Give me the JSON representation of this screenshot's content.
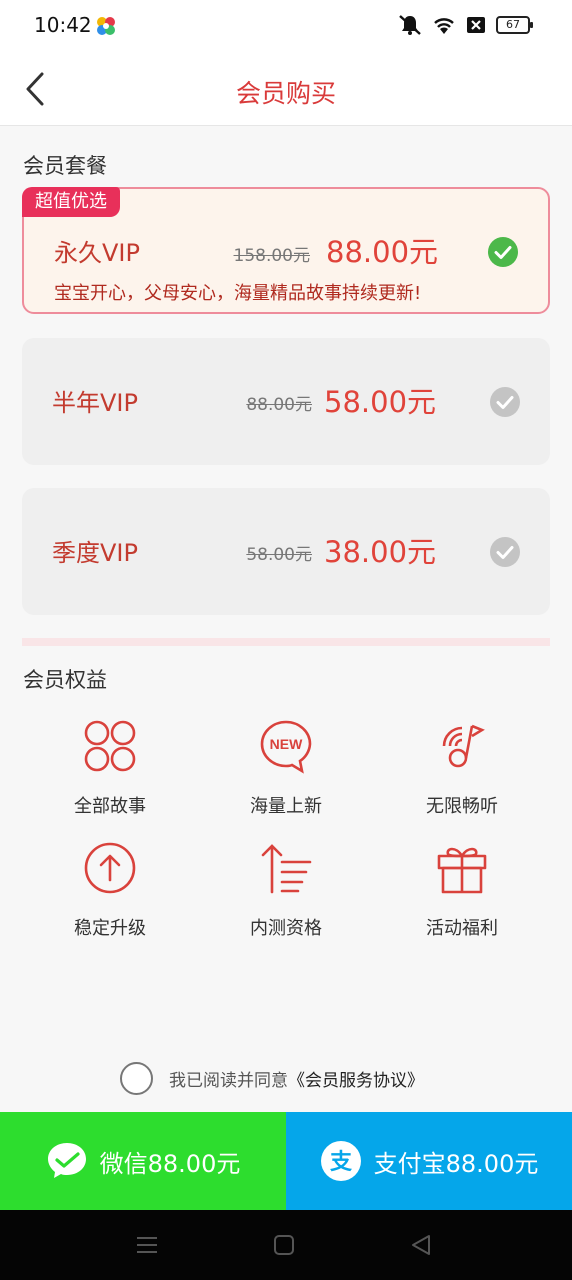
{
  "status": {
    "time": "10:42",
    "battery": "67"
  },
  "header": {
    "title": "会员购买"
  },
  "plans_section": {
    "title": "会员套餐"
  },
  "plans": [
    {
      "badge": "超值优选",
      "name": "永久VIP",
      "old_price": "158.00元",
      "price": "88.00元",
      "desc": "宝宝开心，父母安心，海量精品故事持续更新!",
      "selected": true
    },
    {
      "name": "半年VIP",
      "old_price": "88.00元",
      "price": "58.00元",
      "selected": false
    },
    {
      "name": "季度VIP",
      "old_price": "58.00元",
      "price": "38.00元",
      "selected": false
    }
  ],
  "benefits_section": {
    "title": "会员权益"
  },
  "benefits": [
    {
      "label": "全部故事",
      "icon": "grid-circles-icon"
    },
    {
      "label": "海量上新",
      "icon": "new-bubble-icon",
      "icon_text": "NEW"
    },
    {
      "label": "无限畅听",
      "icon": "music-disc-icon"
    },
    {
      "label": "稳定升级",
      "icon": "upgrade-arrow-icon"
    },
    {
      "label": "内测资格",
      "icon": "list-arrow-icon"
    },
    {
      "label": "活动福利",
      "icon": "gift-icon"
    }
  ],
  "agreement": {
    "text": "我已阅读并同意",
    "link": "《会员服务协议》",
    "checked": false
  },
  "payment": {
    "wechat_label": "微信88.00元",
    "alipay_label": "支付宝88.00元",
    "alipay_icon_char": "支"
  },
  "colors": {
    "accent": "#d93a3a",
    "selected_check": "#4cb84a",
    "wechat": "#2ddd2e",
    "alipay": "#05a6ea"
  }
}
